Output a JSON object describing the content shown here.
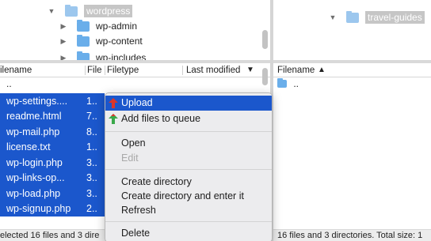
{
  "local_tree": {
    "items": [
      {
        "label": "wordpress",
        "expanded": true,
        "selected": true
      },
      {
        "label": "wp-admin",
        "expanded": false
      },
      {
        "label": "wp-content",
        "expanded": false
      },
      {
        "label": "wp-includes",
        "expanded": false
      }
    ]
  },
  "remote_tree": {
    "items": [
      {
        "label": "travel-guides",
        "expanded": true,
        "selected": true
      }
    ]
  },
  "local_list": {
    "columns": {
      "filename": "ilename",
      "filesize": "File",
      "filetype": "Filetype",
      "last_modified": "Last modified",
      "sort_icon": "chevron-down"
    },
    "parent_entry": "..",
    "files": [
      {
        "name": "wp-settings....",
        "size": "1.."
      },
      {
        "name": "readme.html",
        "size": "7.."
      },
      {
        "name": "wp-mail.php",
        "size": "8.."
      },
      {
        "name": "license.txt",
        "size": "1.."
      },
      {
        "name": "wp-login.php",
        "size": "3.."
      },
      {
        "name": "wp-links-op...",
        "size": "3.."
      },
      {
        "name": "wp-load.php",
        "size": "3.."
      },
      {
        "name": "wp-signup.php",
        "size": "2.."
      }
    ]
  },
  "remote_list": {
    "columns": {
      "filename": "Filename",
      "sort_icon": "chevron-up"
    },
    "parent_entry": ".."
  },
  "context_menu": {
    "upload": "Upload",
    "add_to_queue": "Add files to queue",
    "open": "Open",
    "edit": "Edit",
    "create_directory": "Create directory",
    "create_directory_enter": "Create directory and enter it",
    "refresh": "Refresh",
    "delete": "Delete"
  },
  "status": {
    "local": "elected 16 files and 3 dire",
    "remote": "16 files and 3 directories. Total size: 1"
  },
  "colors": {
    "selection": "#1b57cc",
    "folder": "#6aaeea",
    "upload_arrow": "#d9362b",
    "queue_arrow": "#3aa84a"
  }
}
